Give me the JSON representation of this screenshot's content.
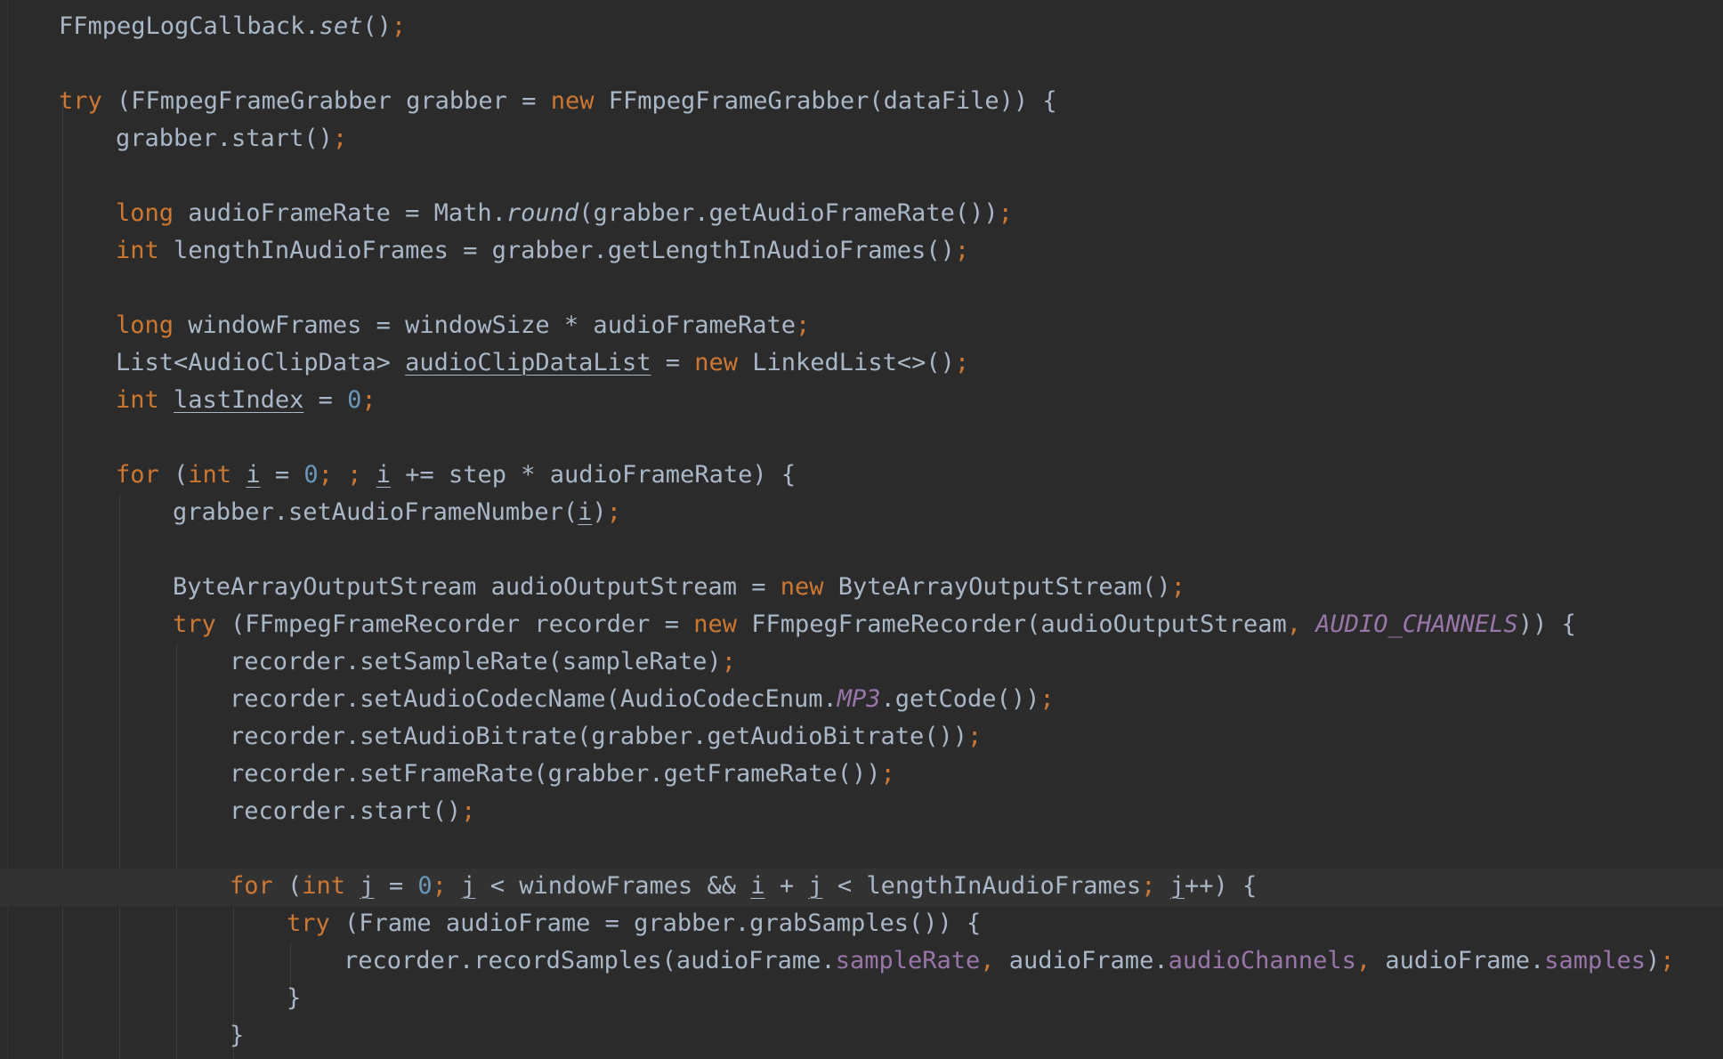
{
  "editor": {
    "theme_colors": {
      "background": "#2b2b2b",
      "caret_line": "#323232",
      "text": "#a9b7c6",
      "keyword": "#cc7832",
      "number": "#6897bb",
      "field": "#9876aa"
    },
    "caret_line_index": 23,
    "lines": [
      {
        "indent": 0,
        "tokens": [
          {
            "t": "FFmpegLogCallback."
          },
          {
            "t": "set",
            "k": "static"
          },
          {
            "t": "()"
          },
          {
            "t": ";",
            "k": "punct"
          }
        ]
      },
      {
        "indent": 0,
        "tokens": []
      },
      {
        "indent": 0,
        "tokens": [
          {
            "t": "try",
            "k": "keyword"
          },
          {
            "t": " (FFmpegFrameGrabber grabber = "
          },
          {
            "t": "new",
            "k": "keyword"
          },
          {
            "t": " FFmpegFrameGrabber(dataFile)) {"
          }
        ]
      },
      {
        "indent": 1,
        "tokens": [
          {
            "t": "grabber.start()"
          },
          {
            "t": ";",
            "k": "punct"
          }
        ]
      },
      {
        "indent": 1,
        "tokens": []
      },
      {
        "indent": 1,
        "tokens": [
          {
            "t": "long",
            "k": "keyword"
          },
          {
            "t": " audioFrameRate = Math."
          },
          {
            "t": "round",
            "k": "static"
          },
          {
            "t": "(grabber.getAudioFrameRate())"
          },
          {
            "t": ";",
            "k": "punct"
          }
        ]
      },
      {
        "indent": 1,
        "tokens": [
          {
            "t": "int",
            "k": "keyword"
          },
          {
            "t": " lengthInAudioFrames = grabber.getLengthInAudioFrames()"
          },
          {
            "t": ";",
            "k": "punct"
          }
        ]
      },
      {
        "indent": 1,
        "tokens": []
      },
      {
        "indent": 1,
        "tokens": [
          {
            "t": "long",
            "k": "keyword"
          },
          {
            "t": " windowFrames = windowSize * audioFrameRate"
          },
          {
            "t": ";",
            "k": "punct"
          }
        ]
      },
      {
        "indent": 1,
        "tokens": [
          {
            "t": "List<AudioClipData> "
          },
          {
            "t": "audioClipDataList",
            "k": "reassigned"
          },
          {
            "t": " = "
          },
          {
            "t": "new",
            "k": "keyword"
          },
          {
            "t": " LinkedList<>()"
          },
          {
            "t": ";",
            "k": "punct"
          }
        ]
      },
      {
        "indent": 1,
        "tokens": [
          {
            "t": "int",
            "k": "keyword"
          },
          {
            "t": " "
          },
          {
            "t": "lastIndex",
            "k": "reassigned"
          },
          {
            "t": " = "
          },
          {
            "t": "0",
            "k": "number"
          },
          {
            "t": ";",
            "k": "punct"
          }
        ]
      },
      {
        "indent": 1,
        "tokens": []
      },
      {
        "indent": 1,
        "tokens": [
          {
            "t": "for",
            "k": "keyword"
          },
          {
            "t": " ("
          },
          {
            "t": "int",
            "k": "keyword"
          },
          {
            "t": " "
          },
          {
            "t": "i",
            "k": "reassigned"
          },
          {
            "t": " = "
          },
          {
            "t": "0",
            "k": "number"
          },
          {
            "t": "; ; ",
            "k": "punct"
          },
          {
            "t": "i",
            "k": "reassigned"
          },
          {
            "t": " += step * audioFrameRate) {"
          }
        ]
      },
      {
        "indent": 2,
        "tokens": [
          {
            "t": "grabber.setAudioFrameNumber("
          },
          {
            "t": "i",
            "k": "reassigned"
          },
          {
            "t": ")"
          },
          {
            "t": ";",
            "k": "punct"
          }
        ]
      },
      {
        "indent": 2,
        "tokens": []
      },
      {
        "indent": 2,
        "tokens": [
          {
            "t": "ByteArrayOutputStream audioOutputStream = "
          },
          {
            "t": "new",
            "k": "keyword"
          },
          {
            "t": " ByteArrayOutputStream()"
          },
          {
            "t": ";",
            "k": "punct"
          }
        ]
      },
      {
        "indent": 2,
        "tokens": [
          {
            "t": "try",
            "k": "keyword"
          },
          {
            "t": " (FFmpegFrameRecorder recorder = "
          },
          {
            "t": "new",
            "k": "keyword"
          },
          {
            "t": " FFmpegFrameRecorder(audioOutputStream"
          },
          {
            "t": ", ",
            "k": "punct"
          },
          {
            "t": "AUDIO_CHANNELS",
            "k": "const"
          },
          {
            "t": ")) {"
          }
        ]
      },
      {
        "indent": 3,
        "tokens": [
          {
            "t": "recorder.setSampleRate(sampleRate)"
          },
          {
            "t": ";",
            "k": "punct"
          }
        ]
      },
      {
        "indent": 3,
        "tokens": [
          {
            "t": "recorder.setAudioCodecName(AudioCodecEnum."
          },
          {
            "t": "MP3",
            "k": "const"
          },
          {
            "t": ".getCode())"
          },
          {
            "t": ";",
            "k": "punct"
          }
        ]
      },
      {
        "indent": 3,
        "tokens": [
          {
            "t": "recorder.setAudioBitrate(grabber.getAudioBitrate())"
          },
          {
            "t": ";",
            "k": "punct"
          }
        ]
      },
      {
        "indent": 3,
        "tokens": [
          {
            "t": "recorder.setFrameRate(grabber.getFrameRate())"
          },
          {
            "t": ";",
            "k": "punct"
          }
        ]
      },
      {
        "indent": 3,
        "tokens": [
          {
            "t": "recorder.start()"
          },
          {
            "t": ";",
            "k": "punct"
          }
        ]
      },
      {
        "indent": 3,
        "tokens": []
      },
      {
        "indent": 3,
        "tokens": [
          {
            "t": "for",
            "k": "keyword"
          },
          {
            "t": " ("
          },
          {
            "t": "int",
            "k": "keyword"
          },
          {
            "t": " "
          },
          {
            "t": "j",
            "k": "reassigned"
          },
          {
            "t": " = "
          },
          {
            "t": "0",
            "k": "number"
          },
          {
            "t": "; ",
            "k": "punct"
          },
          {
            "t": "j",
            "k": "reassigned"
          },
          {
            "t": " < windowFrames && "
          },
          {
            "t": "i",
            "k": "reassigned"
          },
          {
            "t": " + "
          },
          {
            "t": "j",
            "k": "reassigned"
          },
          {
            "t": " < lengthInAudioFrames"
          },
          {
            "t": "; ",
            "k": "punct"
          },
          {
            "t": "j",
            "k": "reassigned"
          },
          {
            "t": "++) {"
          }
        ]
      },
      {
        "indent": 4,
        "tokens": [
          {
            "t": "try",
            "k": "keyword"
          },
          {
            "t": " (Frame audioFrame = grabber.grabSamples()) {"
          }
        ]
      },
      {
        "indent": 5,
        "tokens": [
          {
            "t": "recorder.recordSamples(audioFrame."
          },
          {
            "t": "sampleRate",
            "k": "field"
          },
          {
            "t": ", ",
            "k": "punct"
          },
          {
            "t": "audioFrame."
          },
          {
            "t": "audioChannels",
            "k": "field"
          },
          {
            "t": ", ",
            "k": "punct"
          },
          {
            "t": "audioFrame."
          },
          {
            "t": "samples",
            "k": "field"
          },
          {
            "t": ")"
          },
          {
            "t": ";",
            "k": "punct"
          }
        ]
      },
      {
        "indent": 4,
        "tokens": [
          {
            "t": "}"
          }
        ]
      },
      {
        "indent": 3,
        "tokens": [
          {
            "t": "}"
          }
        ]
      }
    ]
  }
}
